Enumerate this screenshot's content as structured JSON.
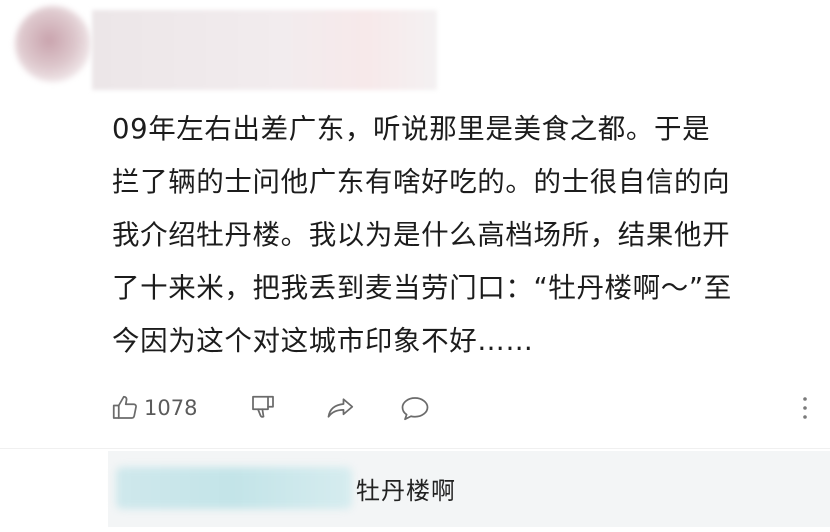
{
  "comment": {
    "text": "09年左右出差广东，听说那里是美食之都。于是\n拦了辆的士问他广东有啥好吃的。的士很自信的向\n我介绍牡丹楼。我以为是什么高档场所，结果他开\n了十来米，把我丢到麦当劳门口：“牡丹楼啊～”至\n今因为这个对这城市印象不好……"
  },
  "actions": {
    "like_count": "1078",
    "icons": [
      "thumbs-up-icon",
      "thumbs-down-icon",
      "share-icon",
      "comment-icon",
      "more-vertical-icon"
    ]
  },
  "reply": {
    "text": "牡丹楼啊"
  },
  "colors": {
    "icon": "#6b6b6b",
    "text": "#1c1c1c",
    "reply_bg": "#f3f5f6"
  }
}
